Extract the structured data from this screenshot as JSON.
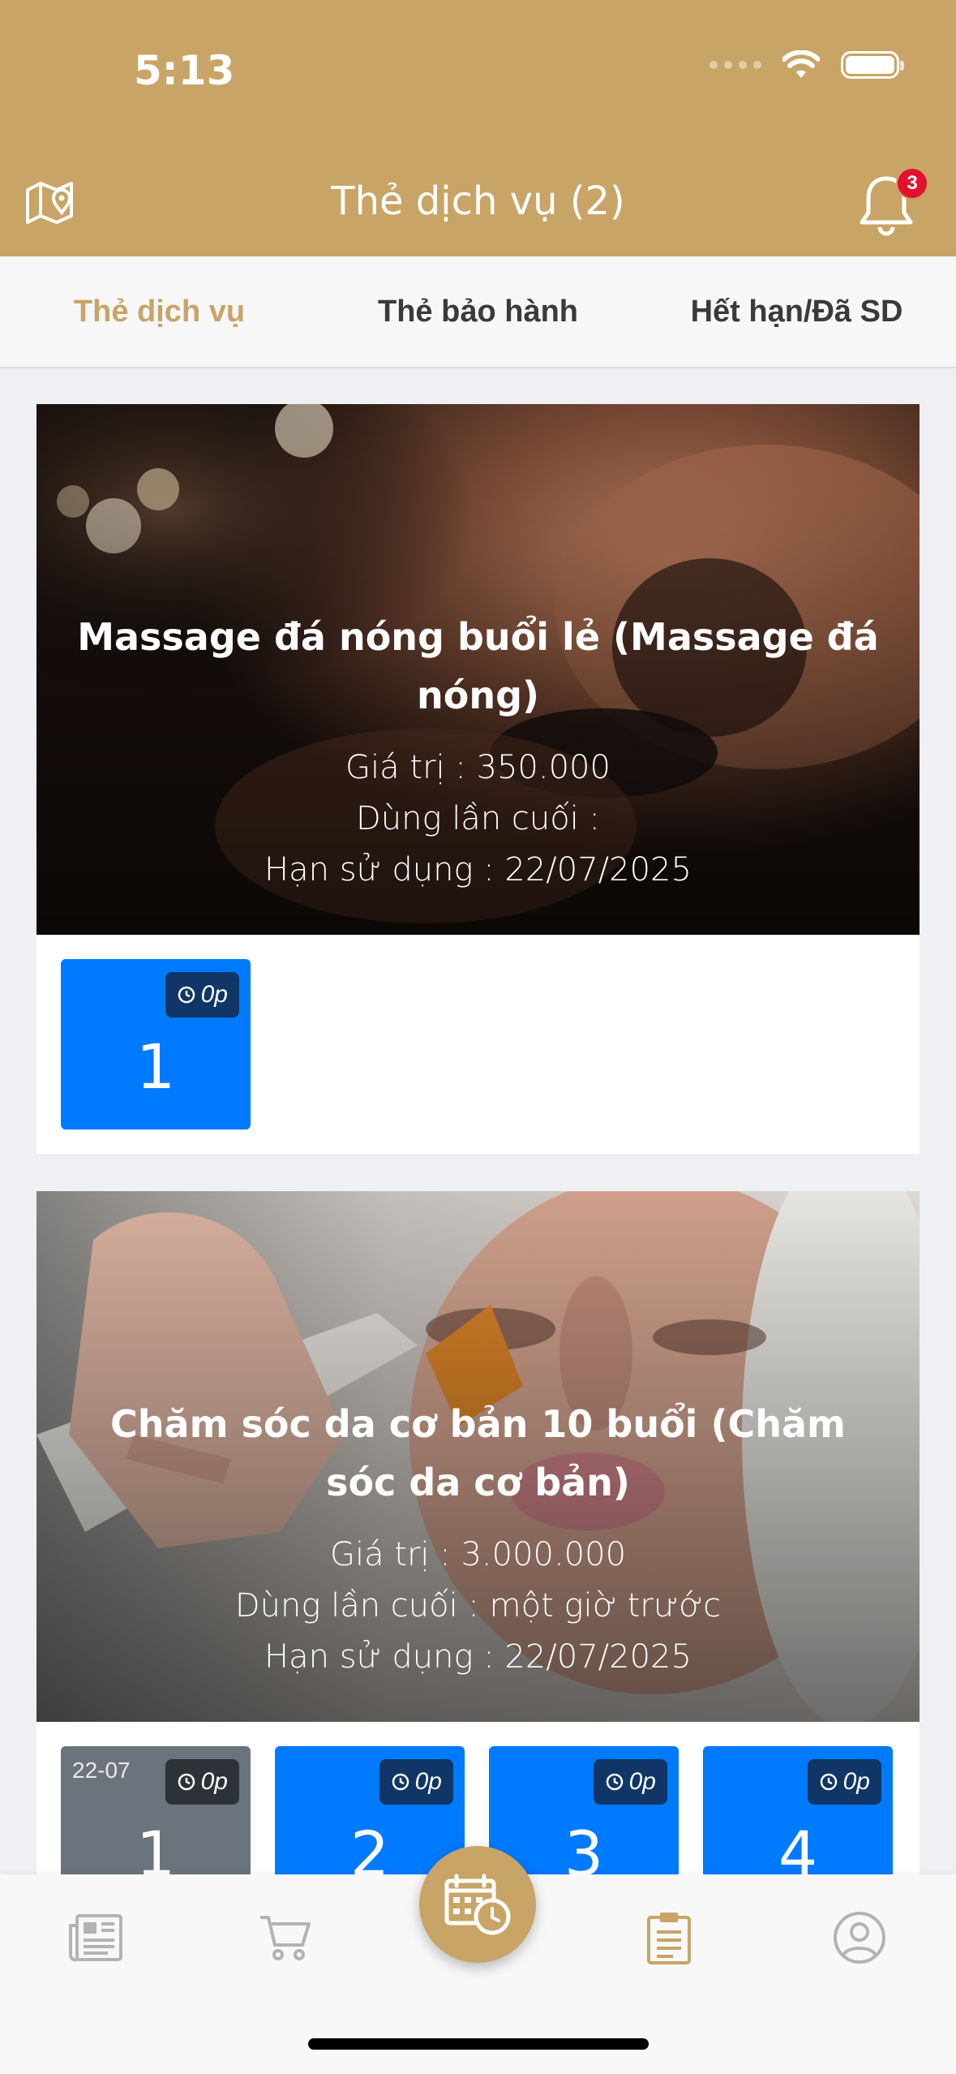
{
  "status_bar": {
    "time": "5:13"
  },
  "header": {
    "title": "Thẻ dịch vụ (2)",
    "notification_count": "3"
  },
  "tabs": [
    {
      "label": "Thẻ dịch vụ",
      "active": true
    },
    {
      "label": "Thẻ bảo hành",
      "active": false
    },
    {
      "label": "Hết hạn/Đã SD",
      "active": false
    }
  ],
  "cards": [
    {
      "title": "Massage đá nóng buổi lẻ (Massage đá nóng)",
      "value_line": "Giá trị : 350.000",
      "last_used_line": "Dùng lần cuối :",
      "expiry_line": "Hạn sử dụng : 22/07/2025",
      "sessions": [
        {
          "number": "1",
          "duration": "0p",
          "date": "",
          "used": false
        }
      ]
    },
    {
      "title": "Chăm sóc da cơ bản 10 buổi (Chăm sóc da cơ bản)",
      "value_line": "Giá trị : 3.000.000",
      "last_used_line": "Dùng lần cuối : một giờ trước",
      "expiry_line": "Hạn sử dụng : 22/07/2025",
      "sessions": [
        {
          "number": "1",
          "duration": "0p",
          "date": "22-07",
          "used": true
        },
        {
          "number": "2",
          "duration": "0p",
          "date": "",
          "used": false
        },
        {
          "number": "3",
          "duration": "0p",
          "date": "",
          "used": false
        },
        {
          "number": "4",
          "duration": "0p",
          "date": "",
          "used": false
        }
      ]
    }
  ],
  "bottom_nav": {
    "items": [
      "news-icon",
      "cart-icon",
      "calendar-clock-icon",
      "clipboard-icon",
      "user-icon"
    ],
    "active": "clipboard-icon"
  },
  "colors": {
    "brand": "#c8a466",
    "session_blue": "#007aff",
    "session_used": "#6b737c",
    "badge_red": "#e3112b"
  }
}
